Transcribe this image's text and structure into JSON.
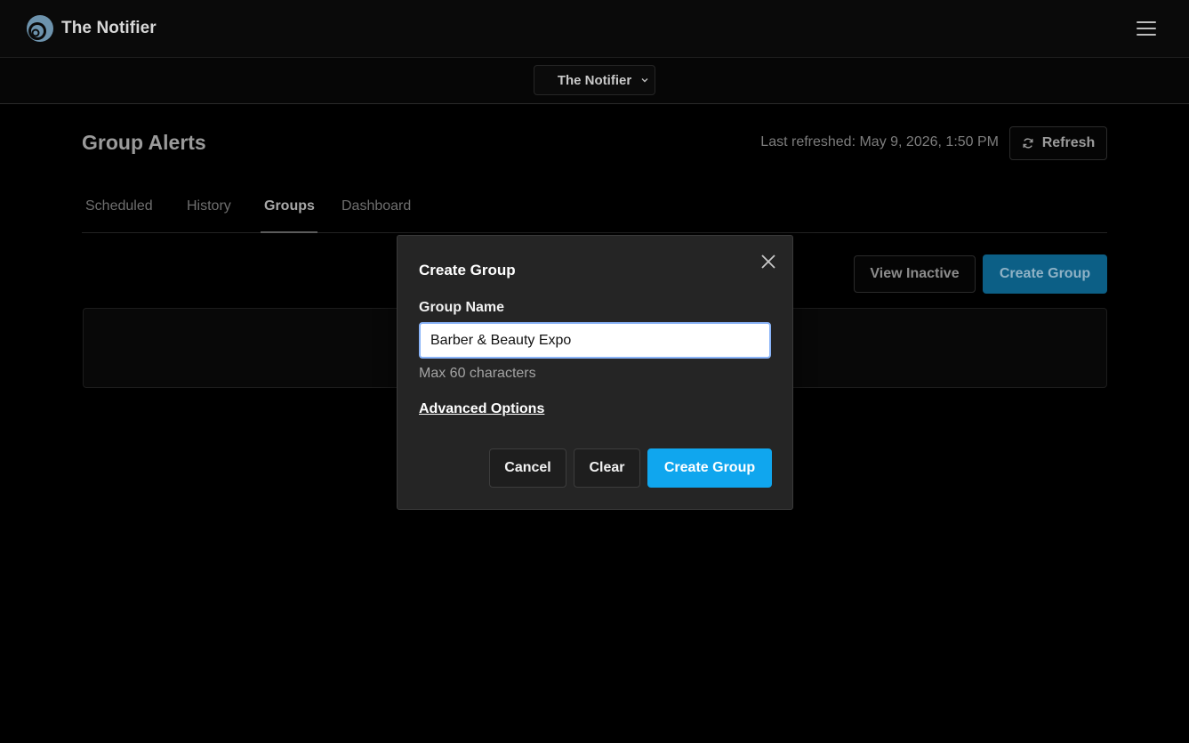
{
  "app": {
    "name": "The Notifier"
  },
  "org_selector": {
    "selected": "The Notifier"
  },
  "page": {
    "title": "Group Alerts",
    "last_refreshed": "Last refreshed: May 9, 2026, 1:50 PM",
    "refresh_label": "Refresh"
  },
  "tabs": [
    {
      "label": "Scheduled"
    },
    {
      "label": "History"
    },
    {
      "label": "Groups",
      "active": true
    },
    {
      "label": "Dashboard"
    }
  ],
  "actions": {
    "view_inactive": "View Inactive",
    "create_group": "Create Group"
  },
  "modal": {
    "title": "Create Group",
    "field_label": "Group Name",
    "field_value": "Barber & Beauty Expo",
    "hint": "Max 60 characters",
    "advanced_link": "Advanced Options",
    "cancel": "Cancel",
    "clear": "Clear",
    "submit": "Create Group"
  },
  "colors": {
    "accent": "#10a6ee",
    "accent_dim": "#0c5f86",
    "background": "#000000",
    "modal_bg": "#252525"
  },
  "icons": [
    "notifier-logo-icon",
    "hamburger-menu-icon",
    "chevron-down-icon",
    "refresh-icon",
    "close-icon"
  ]
}
